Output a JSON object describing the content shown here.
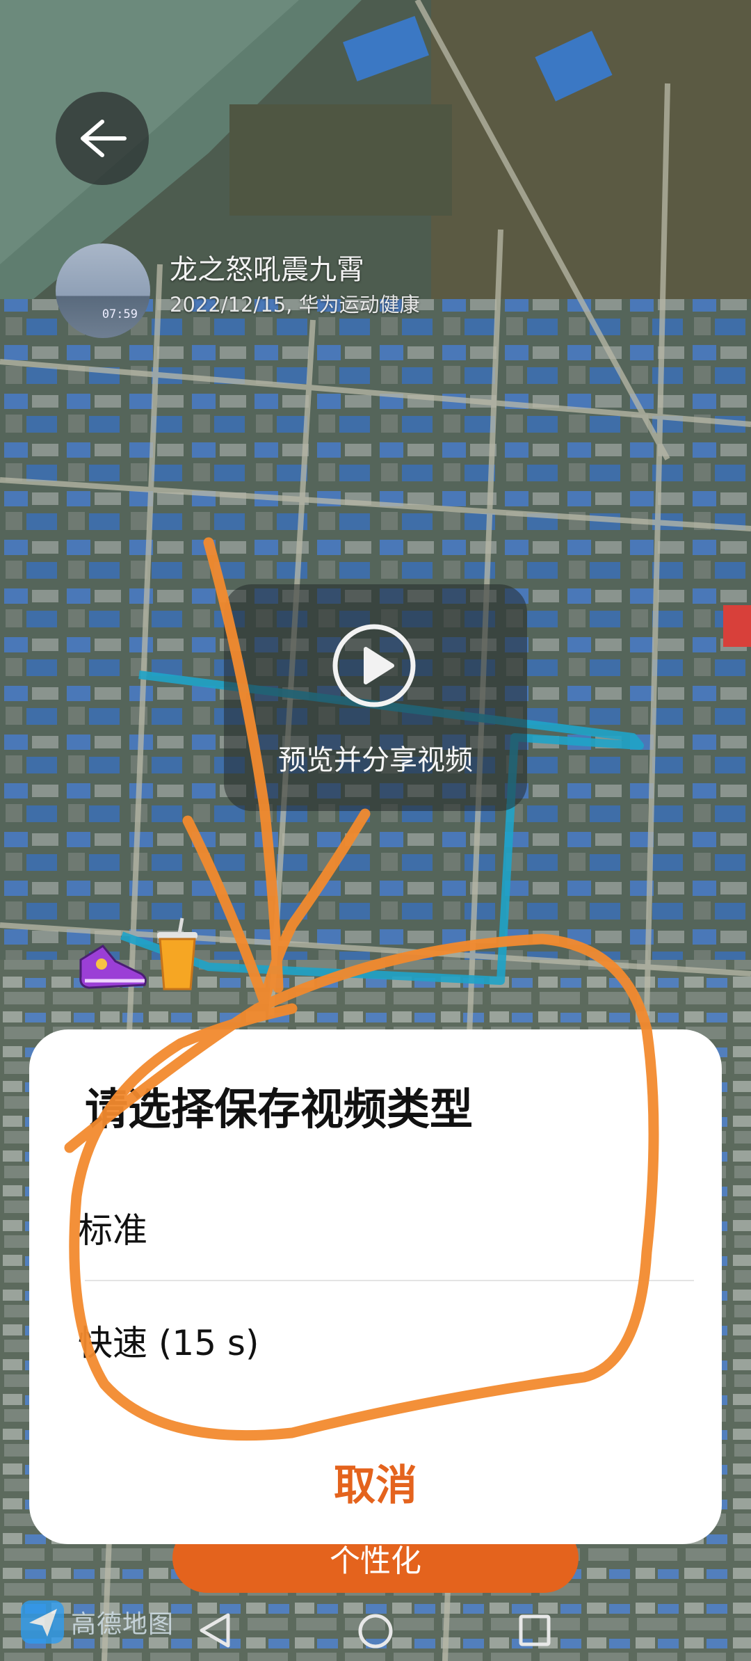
{
  "header": {
    "back_icon": "arrow-left-icon",
    "user_name": "龙之怒吼震九霄",
    "meta": "2022/12/15, 华为运动健康",
    "avatar_time": "07:59"
  },
  "preview": {
    "label": "预览并分享视频",
    "icon": "play-icon"
  },
  "stickers": [
    "sneaker-icon",
    "drink-cup-icon"
  ],
  "dialog": {
    "title": "请选择保存视频类型",
    "options": [
      {
        "label": "标准"
      },
      {
        "label": "快速 (15 s)"
      }
    ],
    "cancel_label": "取消"
  },
  "bottom": {
    "customize_label": "个性化",
    "map_provider": "高德地图"
  },
  "navbar": [
    "back-triangle-icon",
    "home-circle-icon",
    "recents-square-icon"
  ],
  "colors": {
    "accent": "#E4631D",
    "route": "#1FA3C8",
    "annotation": "#F28A2E"
  }
}
